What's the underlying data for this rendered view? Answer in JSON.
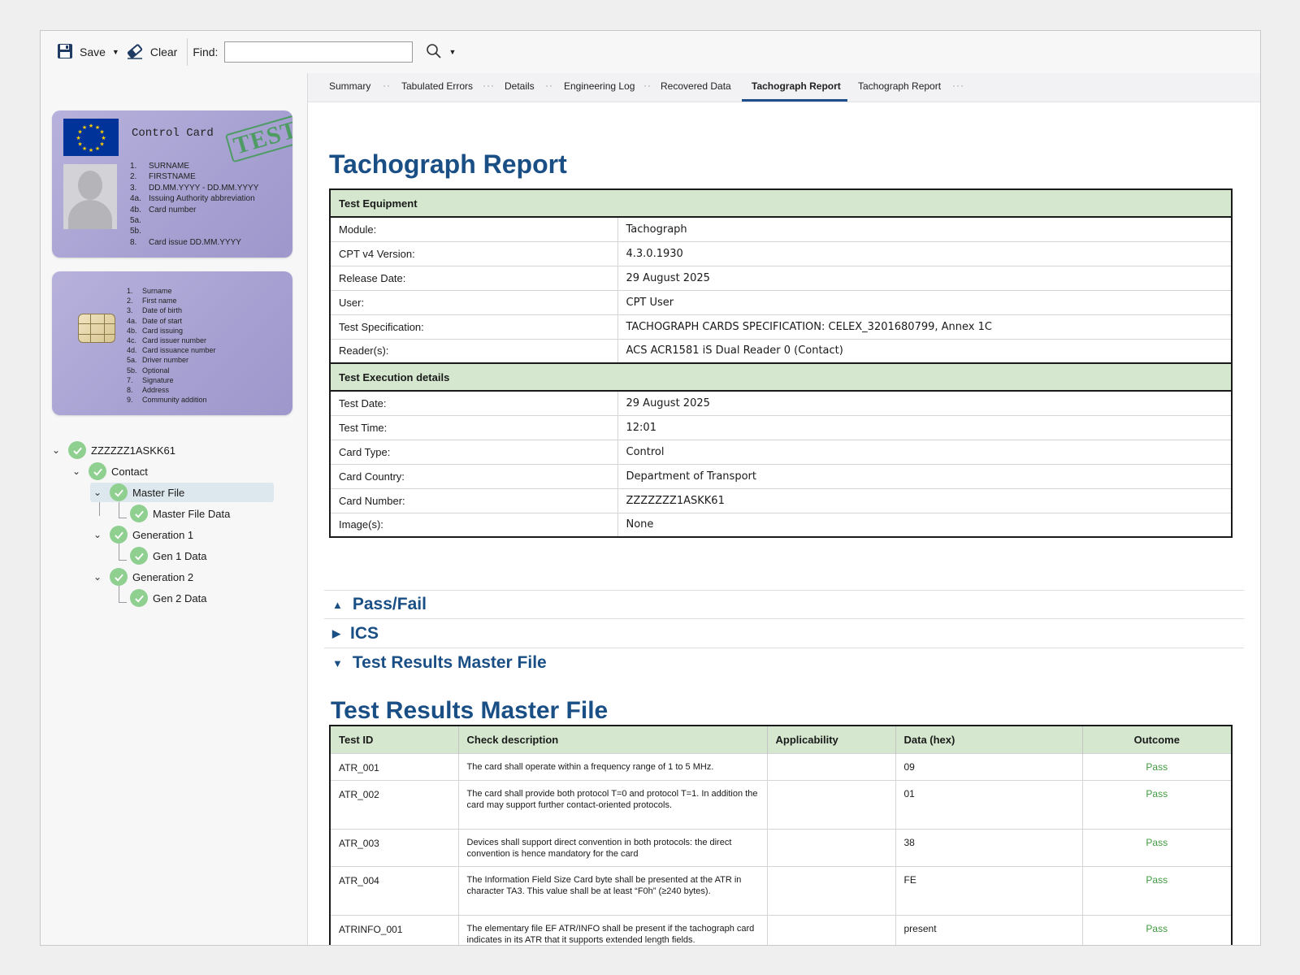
{
  "toolbar": {
    "save_label": "Save",
    "clear_label": "Clear",
    "find_label": "Find:",
    "find_value": ""
  },
  "card_front": {
    "title": "Control Card",
    "stamp": "TEST",
    "fields": [
      {
        "num": "1.",
        "text": "SURNAME"
      },
      {
        "num": "2.",
        "text": "FIRSTNAME"
      },
      {
        "num": "3.",
        "text": "DD.MM.YYYY - DD.MM.YYYY"
      },
      {
        "num": "4a.",
        "text": "Issuing Authority abbreviation"
      },
      {
        "num": "4b.",
        "text": "Card number"
      },
      {
        "num": "5a.",
        "text": ""
      },
      {
        "num": "5b.",
        "text": ""
      },
      {
        "num": "8.",
        "text": "Card issue   DD.MM.YYYY"
      }
    ]
  },
  "card_back": {
    "fields": [
      {
        "num": "1.",
        "text": "Surname"
      },
      {
        "num": "2.",
        "text": "First name"
      },
      {
        "num": "3.",
        "text": "Date of birth"
      },
      {
        "num": "4a.",
        "text": "Date of start"
      },
      {
        "num": "4b.",
        "text": "Card issuing"
      },
      {
        "num": "4c.",
        "text": "Card issuer number"
      },
      {
        "num": "4d.",
        "text": "Card issuance number"
      },
      {
        "num": "5a.",
        "text": "Driver number"
      },
      {
        "num": "5b.",
        "text": "Optional"
      },
      {
        "num": "7.",
        "text": "Signature"
      },
      {
        "num": "8.",
        "text": "Address"
      },
      {
        "num": "9.",
        "text": "Community addition"
      }
    ]
  },
  "tree": [
    {
      "label": "ZZZZZZ1ASKK61",
      "level": 0,
      "expanded": true
    },
    {
      "label": "Contact",
      "level": 1,
      "expanded": true
    },
    {
      "label": "Master File",
      "level": 2,
      "expanded": true,
      "selected": true
    },
    {
      "label": "Master File Data",
      "level": 3
    },
    {
      "label": "Generation 1",
      "level": 2,
      "expanded": true
    },
    {
      "label": "Gen 1 Data",
      "level": 3
    },
    {
      "label": "Generation 2",
      "level": 2,
      "expanded": true
    },
    {
      "label": "Gen 2 Data",
      "level": 3
    }
  ],
  "tabs": [
    {
      "label": "Summary"
    },
    {
      "label": "Tabulated Errors"
    },
    {
      "label": "Details"
    },
    {
      "label": "Engineering Log"
    },
    {
      "label": "Recovered Data"
    },
    {
      "label": "Tachograph Report",
      "active": true
    },
    {
      "label": "Tachograph Report"
    }
  ],
  "report": {
    "title": "Tachograph Report",
    "equipment_header": "Test Equipment",
    "equipment": [
      {
        "key": "Module:",
        "value": "Tachograph"
      },
      {
        "key": "CPT v4 Version:",
        "value": "4.3.0.1930"
      },
      {
        "key": "Release Date:",
        "value": "29 August 2025"
      },
      {
        "key": "User:",
        "value": "CPT User"
      },
      {
        "key": "Test Specification:",
        "value": "TACHOGRAPH CARDS SPECIFICATION: CELEX_3201680799, Annex 1C"
      },
      {
        "key": "Reader(s):",
        "value": "ACS ACR1581 iS Dual Reader 0 (Contact)"
      }
    ],
    "execution_header": "Test Execution details",
    "execution": [
      {
        "key": "Test Date:",
        "value": "29 August 2025"
      },
      {
        "key": "Test Time:",
        "value": "12:01"
      },
      {
        "key": "Card Type:",
        "value": "Control"
      },
      {
        "key": "Card Country:",
        "value": "Department of Transport"
      },
      {
        "key": "Card Number:",
        "value": "ZZZZZZZ1ASKK61"
      },
      {
        "key": "Image(s):",
        "value": "None"
      }
    ]
  },
  "sections": [
    {
      "label": "Pass/Fail",
      "arrow": "▲"
    },
    {
      "label": "ICS",
      "arrow": "▶"
    },
    {
      "label": "Test Results Master File",
      "arrow": "▼"
    }
  ],
  "results": {
    "title": "Test Results Master File",
    "columns": [
      "Test ID",
      "Check description",
      "Applicability",
      "Data (hex)",
      "Outcome"
    ],
    "rows": [
      {
        "id": "ATR_001",
        "desc": "The card shall operate within a frequency range of 1 to 5 MHz.",
        "applicability": "",
        "hex": "09",
        "outcome": "Pass"
      },
      {
        "id": "ATR_002",
        "desc": "The card shall provide both protocol T=0 and protocol T=1. In addition the card may support further contact-oriented protocols.",
        "applicability": "",
        "hex": "01",
        "outcome": "Pass"
      },
      {
        "id": "ATR_003",
        "desc": "Devices shall support direct convention in both protocols: the direct convention is hence mandatory for the card",
        "applicability": "",
        "hex": "38",
        "outcome": "Pass"
      },
      {
        "id": "ATR_004",
        "desc": "The Information Field Size Card byte shall be presented at the ATR in character TA3. This value shall be at least “F0h” (≥240 bytes).",
        "applicability": "",
        "hex": "FE",
        "outcome": "Pass"
      },
      {
        "id": "ATRINFO_001",
        "desc": "The elementary file EF ATR/INFO shall be present if the tachograph card indicates in its ATR that it supports extended length fields.",
        "applicability": "",
        "hex": "present",
        "outcome": "Pass"
      }
    ]
  },
  "colors": {
    "accent": "#1a4f86",
    "header_green": "#d5e8cf",
    "pass": "#3f9a3f",
    "card_purple": "#aaa4d4"
  }
}
